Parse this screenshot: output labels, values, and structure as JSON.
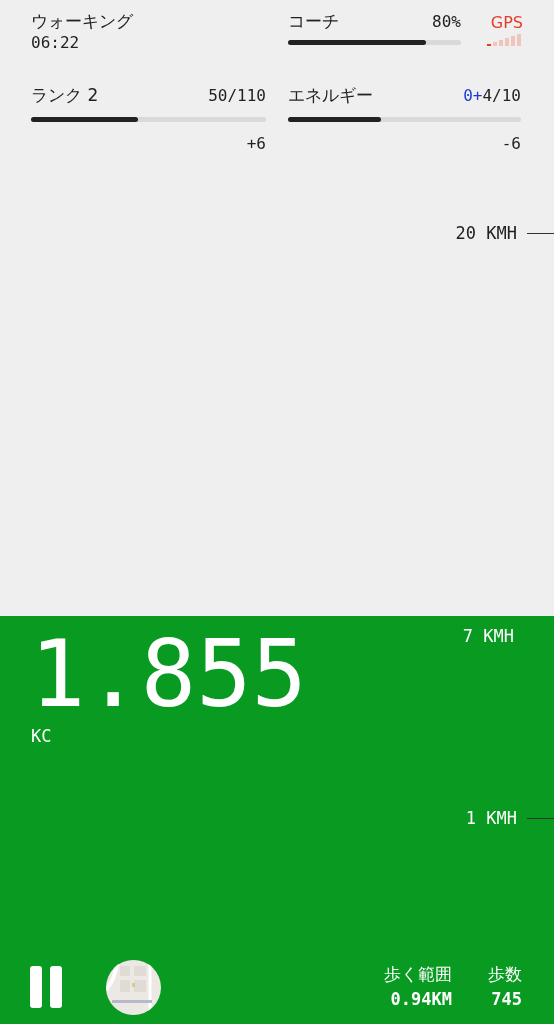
{
  "activity": {
    "title": "ウォーキング",
    "time": "06:22"
  },
  "coach": {
    "label": "コーチ",
    "value": "80%",
    "level": 0.8
  },
  "gps": {
    "label": "GPS"
  },
  "rank": {
    "label": "ランク 2",
    "value": "50/110",
    "level": 0.455,
    "delta": "+6"
  },
  "energy": {
    "label": "エネルギー",
    "bonus": "0+",
    "value": "4/10",
    "level": 0.4,
    "delta": "-6"
  },
  "speed_marks": [
    {
      "label": "20 KMH",
      "line": true
    },
    {
      "label": "7 KMH",
      "line": false
    },
    {
      "label": "1 KMH",
      "line": true
    }
  ],
  "calories": {
    "value": "1.855",
    "unit": "KC"
  },
  "stats": [
    {
      "label": "歩く範囲",
      "value": "0.94KM"
    },
    {
      "label": "歩数",
      "value": "745"
    }
  ]
}
